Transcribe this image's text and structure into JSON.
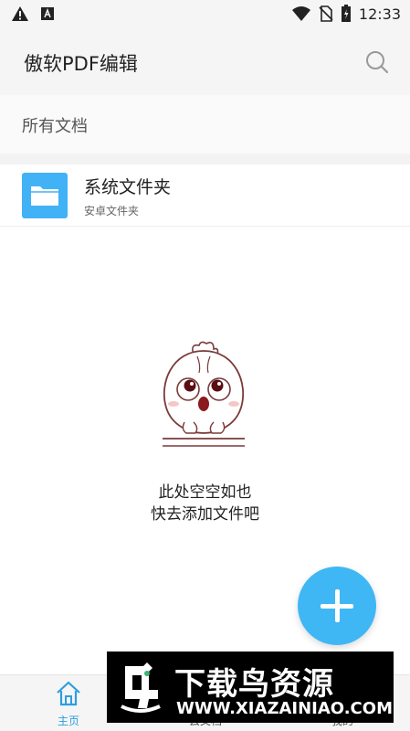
{
  "status_bar": {
    "time": "12:33"
  },
  "app_bar": {
    "title": "傲软PDF编辑"
  },
  "section": {
    "title": "所有文档"
  },
  "folder": {
    "name": "系统文件夹",
    "subtitle": "安卓文件夹"
  },
  "empty_state": {
    "line1": "此处空空如也",
    "line2": "快去添加文件吧"
  },
  "bottom_nav": {
    "items": [
      {
        "label": "主页",
        "icon": "home-icon"
      },
      {
        "label": "云文档",
        "icon": "cloud-icon"
      },
      {
        "label": "我的",
        "icon": "user-icon"
      }
    ]
  },
  "watermark": {
    "title": "下载鸟资源",
    "url": "WWW.XIAZAINIAO.COM"
  },
  "colors": {
    "accent": "#3fb7f5",
    "folder": "#42b2f6",
    "nav_active": "#2f9de0"
  }
}
